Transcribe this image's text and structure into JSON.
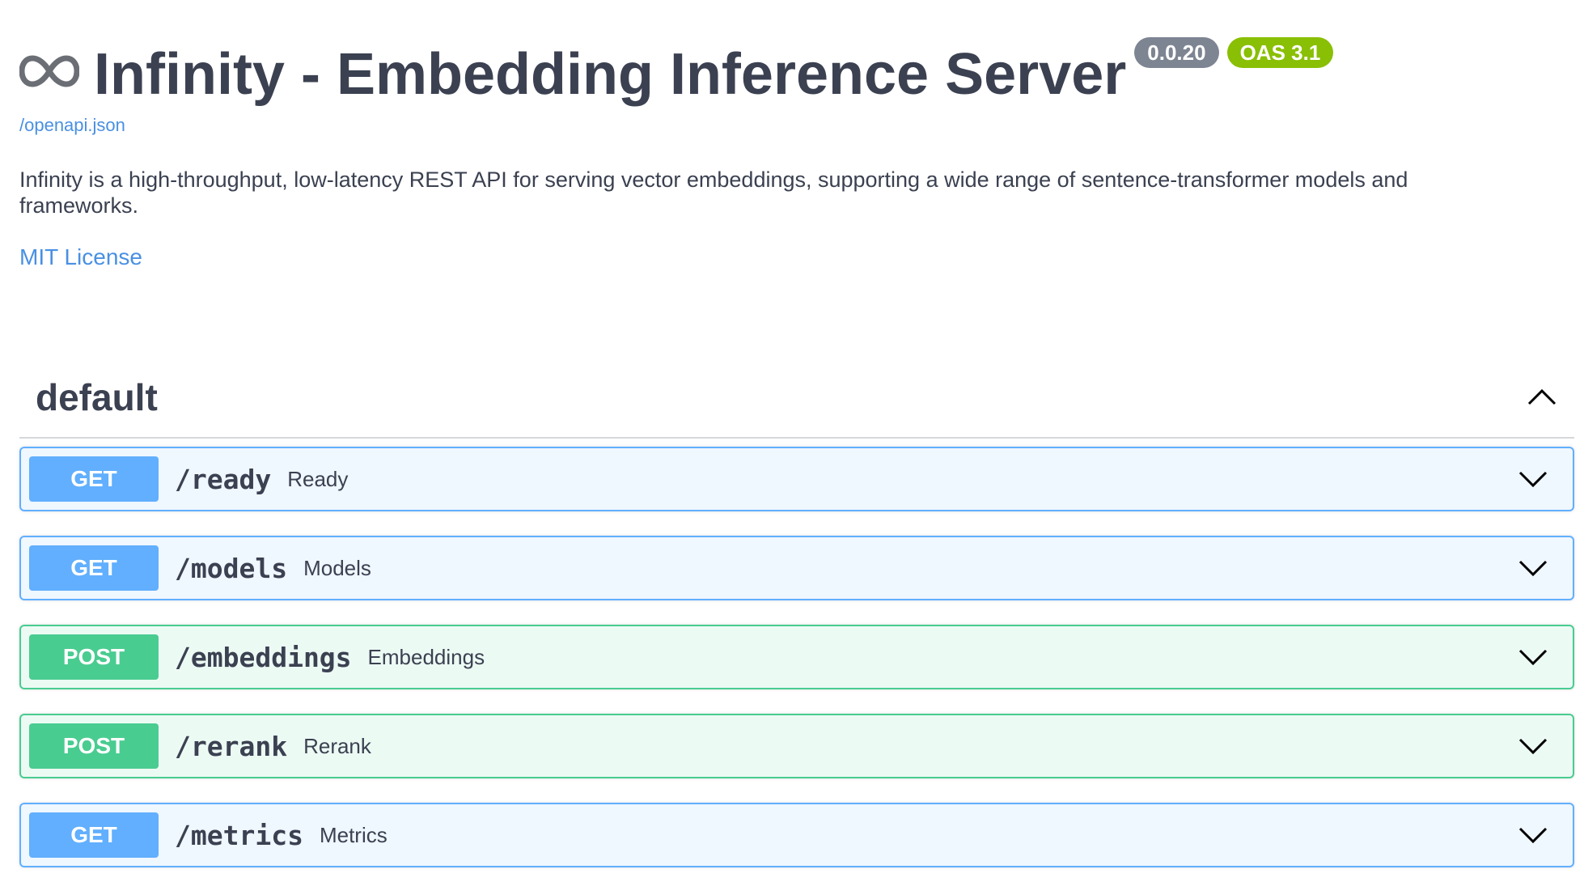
{
  "info": {
    "logo_icon": "infinity-icon",
    "title": "Infinity - Embedding Inference Server",
    "version_badge": "0.0.20",
    "oas_badge": "OAS 3.1",
    "spec_link": "/openapi.json",
    "description": "Infinity is a high-throughput, low-latency REST API for serving vector embeddings, supporting a wide range of sentence-transformer models and frameworks.",
    "license": "MIT License"
  },
  "colors": {
    "text": "#3b4151",
    "link": "#4990e2",
    "version_badge": "#7d8492",
    "oas_badge": "#89bf04",
    "get": "#61afe5",
    "post": "#49cc90"
  },
  "tag": {
    "name": "default",
    "toggle_icon": "chevron-up-icon"
  },
  "operations": [
    {
      "method": "GET",
      "path": "/ready",
      "summary": "Ready"
    },
    {
      "method": "GET",
      "path": "/models",
      "summary": "Models"
    },
    {
      "method": "POST",
      "path": "/embeddings",
      "summary": "Embeddings"
    },
    {
      "method": "POST",
      "path": "/rerank",
      "summary": "Rerank"
    },
    {
      "method": "GET",
      "path": "/metrics",
      "summary": "Metrics"
    }
  ]
}
